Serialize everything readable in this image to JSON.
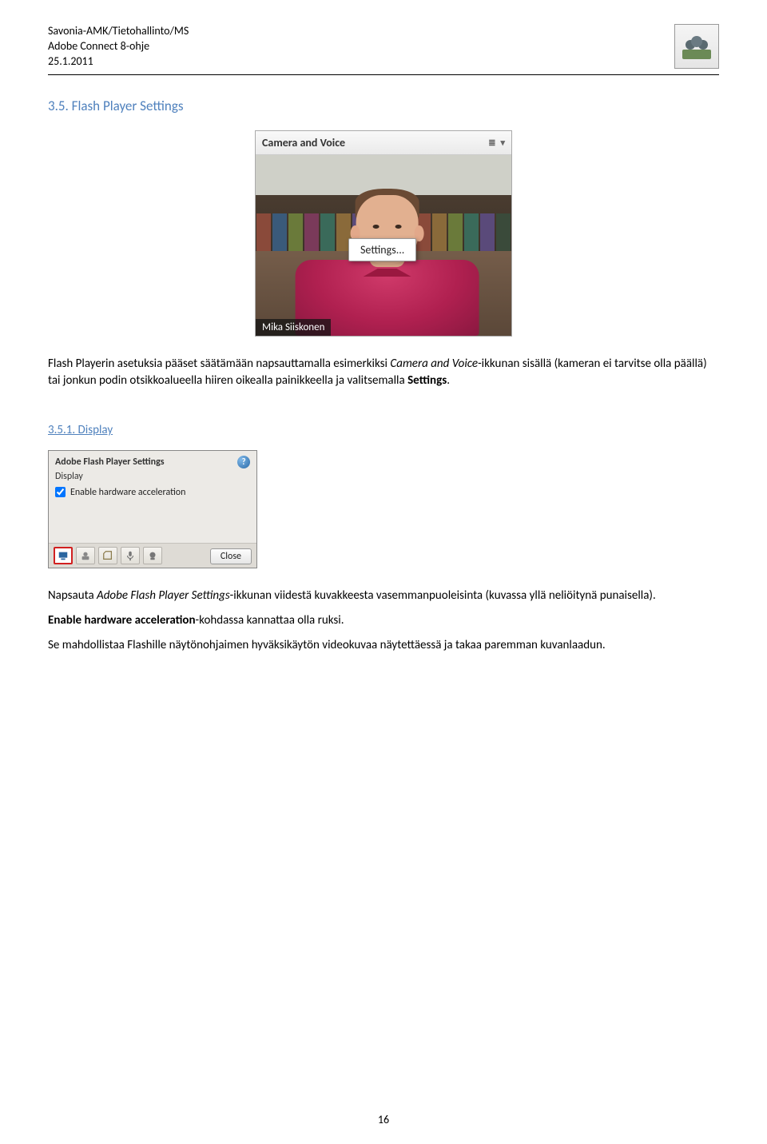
{
  "header": {
    "org": "Savonia-AMK/Tietohallinto/MS",
    "doc": "Adobe Connect 8-ohje",
    "date": "25.1.2011"
  },
  "sec35": {
    "heading": "3.5. Flash Player Settings",
    "panel_title": "Camera and Voice",
    "settings_popup": "Settings...",
    "webcam_name": "Mika Siiskonen",
    "body_pre": "Flash Playerin asetuksia pääset säätämään napsauttamalla esimerkiksi ",
    "body_em1": "Camera and Voice",
    "body_mid": "-ikkunan sisällä (kameran ei tarvitse olla päällä) tai jonkun podin otsikkoalueella hiiren oikealla painikkeella ja valitsemalla ",
    "body_bold": "Settings",
    "body_end": "."
  },
  "sec351": {
    "heading": "3.5.1. Display",
    "dialog_title": "Adobe Flash Player Settings",
    "dialog_subtitle": "Display",
    "checkbox_label": "Enable hardware acceleration",
    "close_label": "Close",
    "p1_pre": "Napsauta ",
    "p1_em": "Adobe Flash Player Settings",
    "p1_post": "-ikkunan viidestä kuvakkeesta vasemmanpuoleisinta (kuvassa yllä neliöitynä punaisella).",
    "p2_bold": "Enable hardware acceleration",
    "p2_post": "-kohdassa kannattaa olla ruksi.",
    "p3": "Se mahdollistaa Flashille näytönohjaimen hyväksikäytön videokuvaa näytettäessä ja takaa paremman kuvanlaadun."
  },
  "page_number": "16"
}
